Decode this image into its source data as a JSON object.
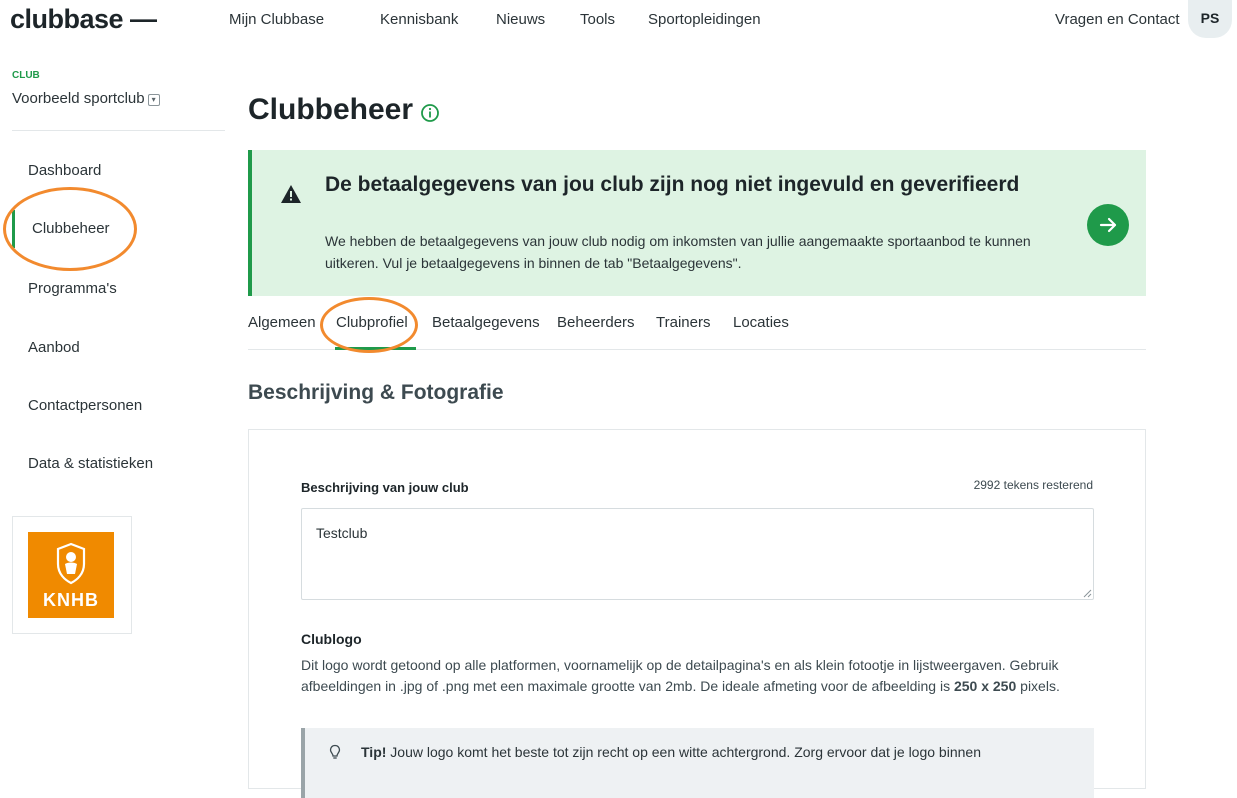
{
  "header": {
    "logo": "clubbase —",
    "nav": [
      "Mijn Clubbase",
      "Kennisbank",
      "Nieuws",
      "Tools",
      "Sportopleidingen"
    ],
    "contact": "Vragen en Contact",
    "avatar_initials": "PS"
  },
  "sidebar": {
    "club_label": "CLUB",
    "club_name": "Voorbeeld sportclub",
    "items": [
      "Dashboard",
      "Clubbeheer",
      "Programma's",
      "Aanbod",
      "Contactpersonen",
      "Data & statistieken"
    ],
    "active_item": "Clubbeheer",
    "sponsor_logo_text": "KNHB"
  },
  "main": {
    "title": "Clubbeheer",
    "alert": {
      "title": "De betaalgegevens van jou club zijn nog niet ingevuld en geverifieerd",
      "text": "We hebben de betaalgegevens van jouw club nodig om inkomsten van jullie aangemaakte sportaanbod te kunnen uitkeren. Vul je betaalgegevens in binnen de tab \"Betaalgegevens\"."
    },
    "tabs": [
      "Algemeen",
      "Clubprofiel",
      "Betaalgegevens",
      "Beheerders",
      "Trainers",
      "Locaties"
    ],
    "active_tab": "Clubprofiel",
    "section_title": "Beschrijving & Fotografie",
    "description": {
      "label": "Beschrijving van jouw club",
      "counter": "2992 tekens resterend",
      "value": "Testclub"
    },
    "clublogo": {
      "label": "Clublogo",
      "desc_part1": "Dit logo wordt getoond op alle platformen, voornamelijk op de detailpagina's en als klein fotootje in lijstweergaven. Gebruik afbeeldingen in .jpg of .png met een maximale grootte van 2mb. De ideale afmeting voor de afbeelding is ",
      "desc_bold": "250 x 250",
      "desc_part2": " pixels."
    },
    "tip": {
      "bold": "Tip!",
      "text": " Jouw logo komt het beste tot zijn recht op een witte achtergrond. Zorg ervoor dat je logo binnen"
    }
  },
  "colors": {
    "accent_green": "#1f9a4a",
    "alert_bg": "#def3e3",
    "highlight_orange": "#f28a2e",
    "knhb_orange": "#f08a00"
  }
}
